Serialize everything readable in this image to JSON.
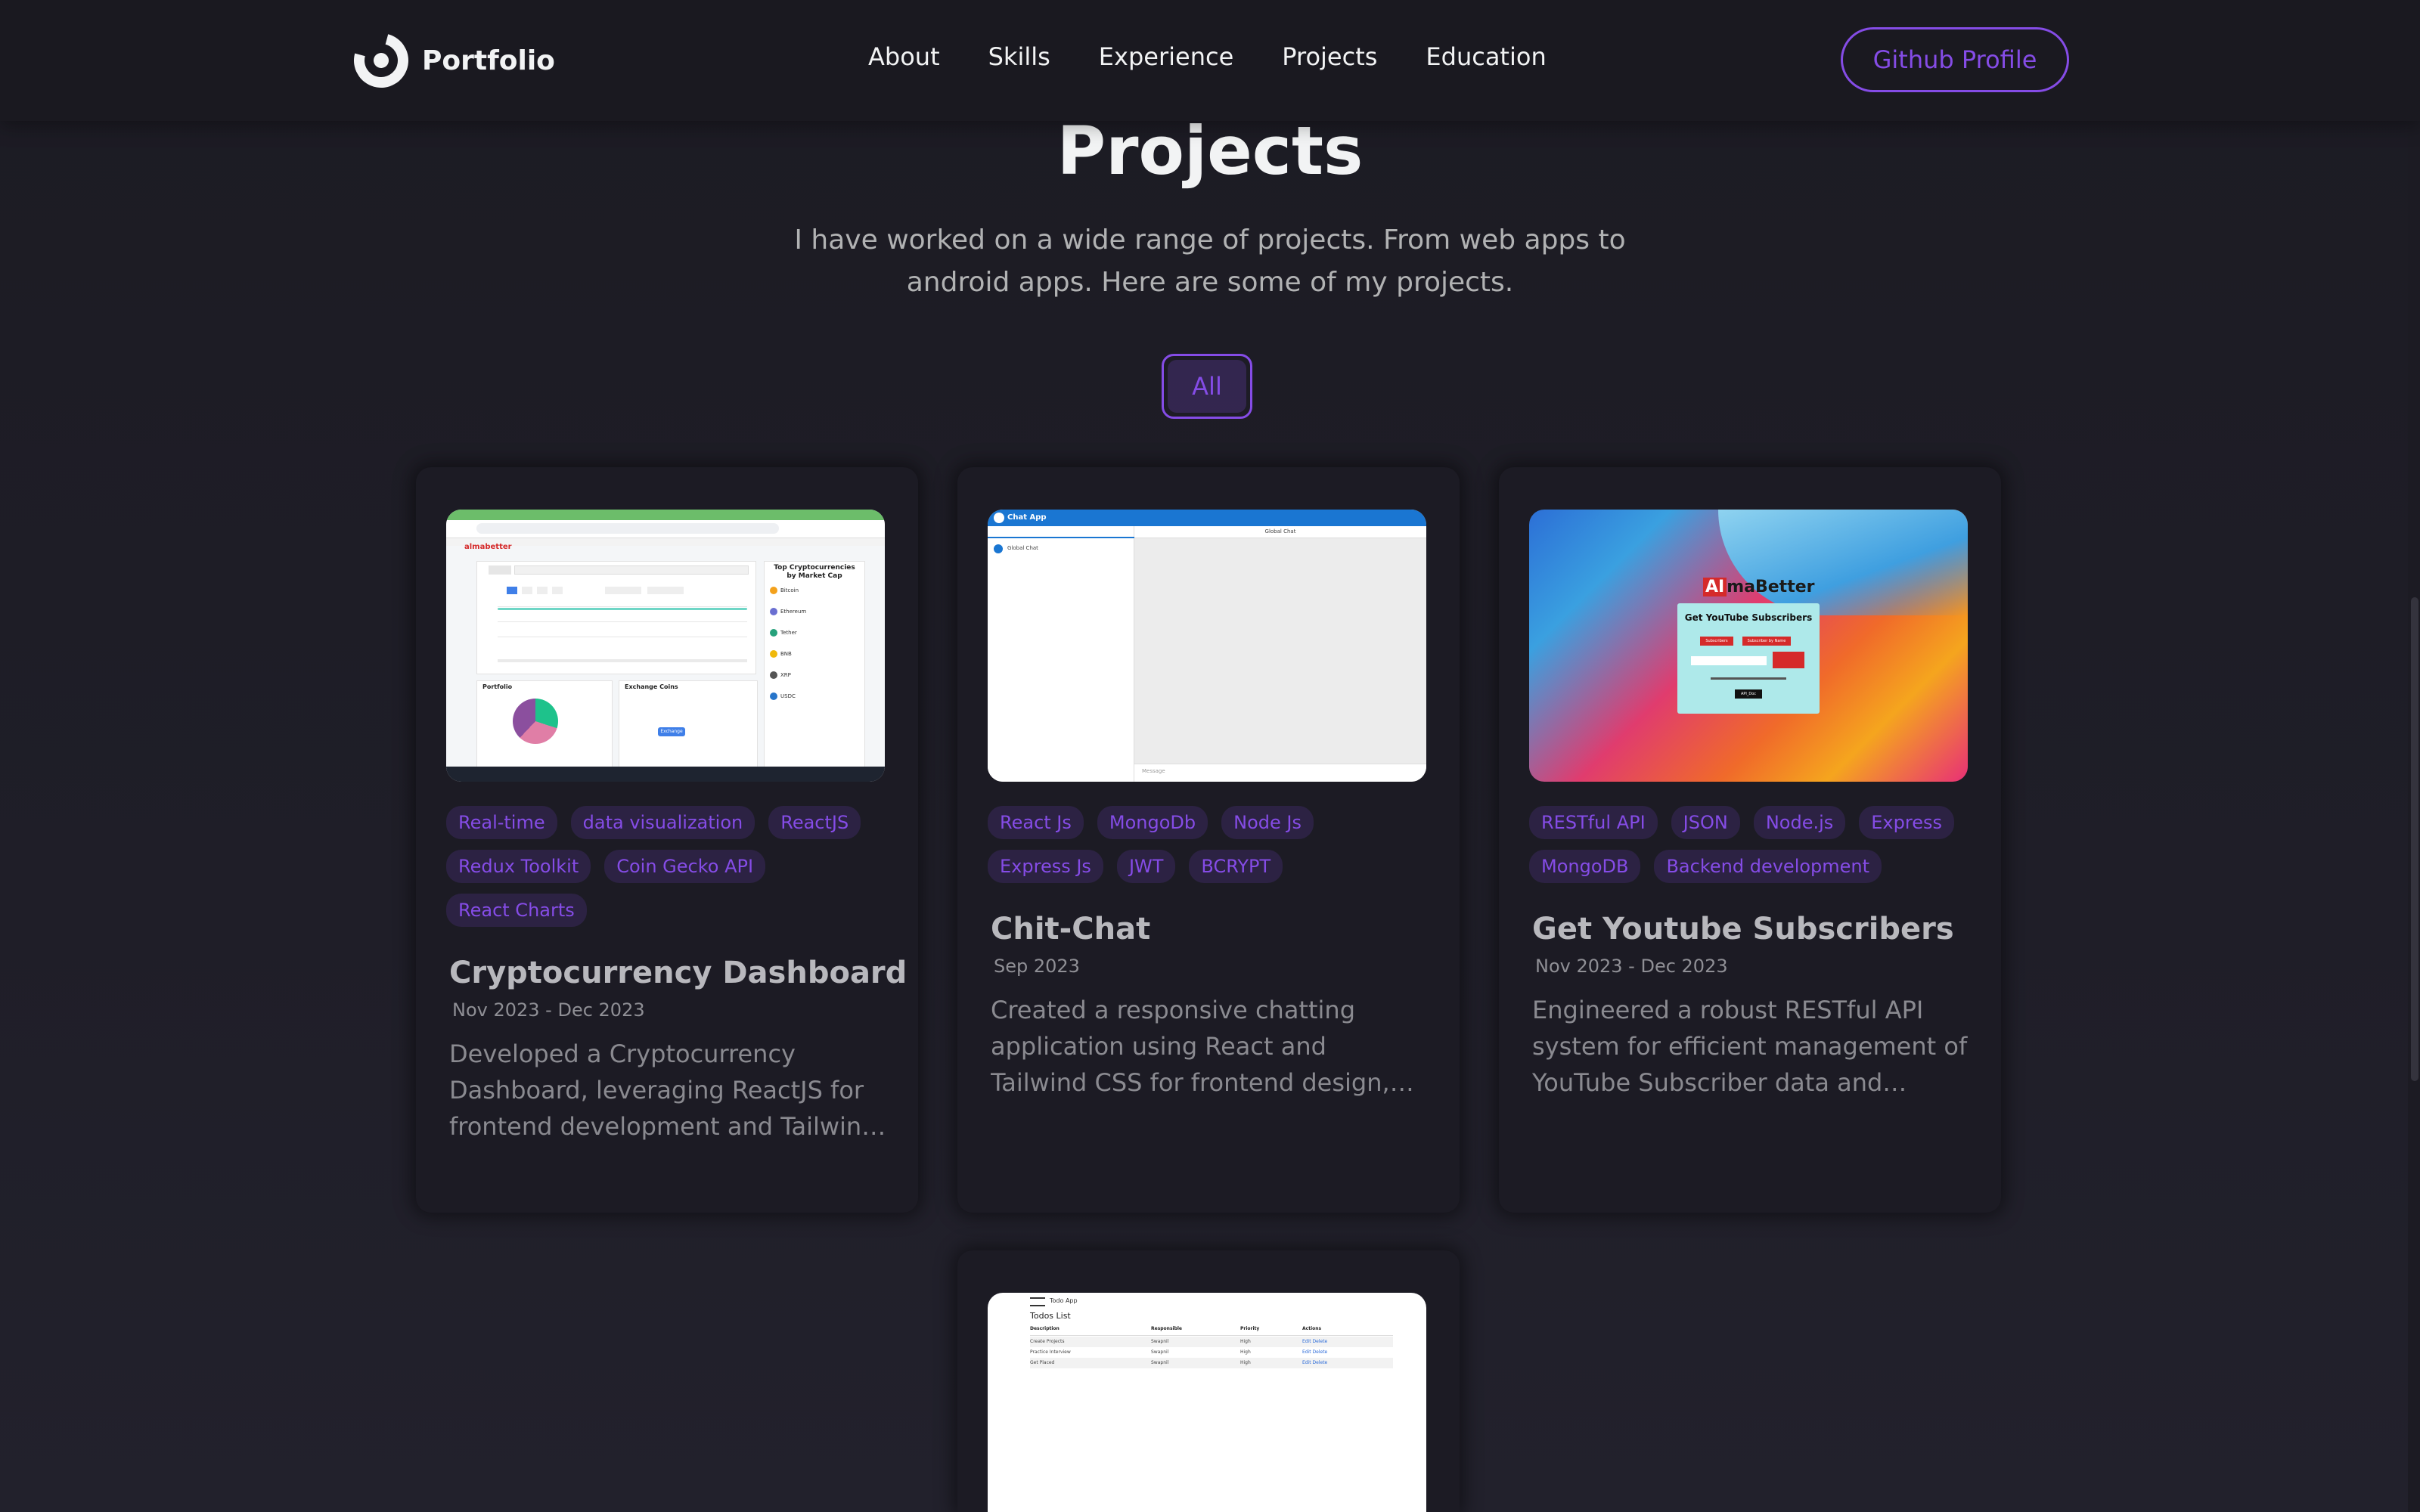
{
  "nav": {
    "logo_text": "Portfolio",
    "links": [
      "About",
      "Skills",
      "Experience",
      "Projects",
      "Education"
    ],
    "github_label": "Github Profile"
  },
  "projects_section": {
    "title": "Projects",
    "description": "I have worked on a wide range of projects. From web apps to android apps. Here are some of my projects.",
    "filter_label": "All"
  },
  "cards": [
    {
      "title": "Cryptocurrency Dashboard",
      "date": "Nov 2023 - Dec 2023",
      "tags": [
        "Real-time",
        "data visualization",
        "ReactJS",
        "Redux Toolkit",
        "Coin Gecko API",
        "React Charts"
      ],
      "description": "Developed a Cryptocurrency Dashboard, leveraging ReactJS for frontend development and Tailwind CSS for styling",
      "screenshot": {
        "brand": "almabetter",
        "sidebar_title": "Top Cryptocurrencies by Market Cap",
        "coins": [
          "Bitcoin",
          "Ethereum",
          "Tether",
          "BNB",
          "XRP",
          "USDC"
        ],
        "portfolio_label": "Portfolio",
        "exchange_label": "Exchange Coins",
        "exchange_button": "Exchange"
      }
    },
    {
      "title": "Chit-Chat",
      "date": "Sep 2023",
      "tags": [
        "React Js",
        "MongoDb",
        "Node Js",
        "Express Js",
        "JWT",
        "BCRYPT"
      ],
      "description": "Created a responsive chatting application using React and Tailwind CSS for frontend design, with real-time messaging",
      "screenshot": {
        "app_title": "Chat App",
        "panel_title": "Global Chat",
        "user": "Global Chat",
        "message_placeholder": "Message"
      }
    },
    {
      "title": "Get Youtube Subscribers",
      "date": "Nov 2023 - Dec 2023",
      "tags": [
        "RESTful API",
        "JSON",
        "Node.js",
        "Express",
        "MongoDB",
        "Backend development"
      ],
      "description": "Engineered a robust RESTful API system for efficient management of YouTube Subscriber data and retrieval",
      "screenshot": {
        "brand_ai": "AI",
        "brand_rest": "maBetter",
        "box_title": "Get YouTube Subscribers",
        "btn1": "Subscribers",
        "btn2": "Subscriber by Name",
        "api_btn": "API_Doc"
      }
    },
    {
      "screenshot": {
        "app_title": "Todo App",
        "heading": "Todos List",
        "columns": [
          "Description",
          "Responsible",
          "Priority",
          "Actions"
        ],
        "rows": [
          [
            "Create Projects",
            "Swapnil",
            "High",
            "Edit Delete"
          ],
          [
            "Practice Interview",
            "Swapnil",
            "High",
            "Edit Delete"
          ],
          [
            "Get Placed",
            "Swapnil",
            "High",
            "Edit Delete"
          ]
        ]
      }
    }
  ]
}
